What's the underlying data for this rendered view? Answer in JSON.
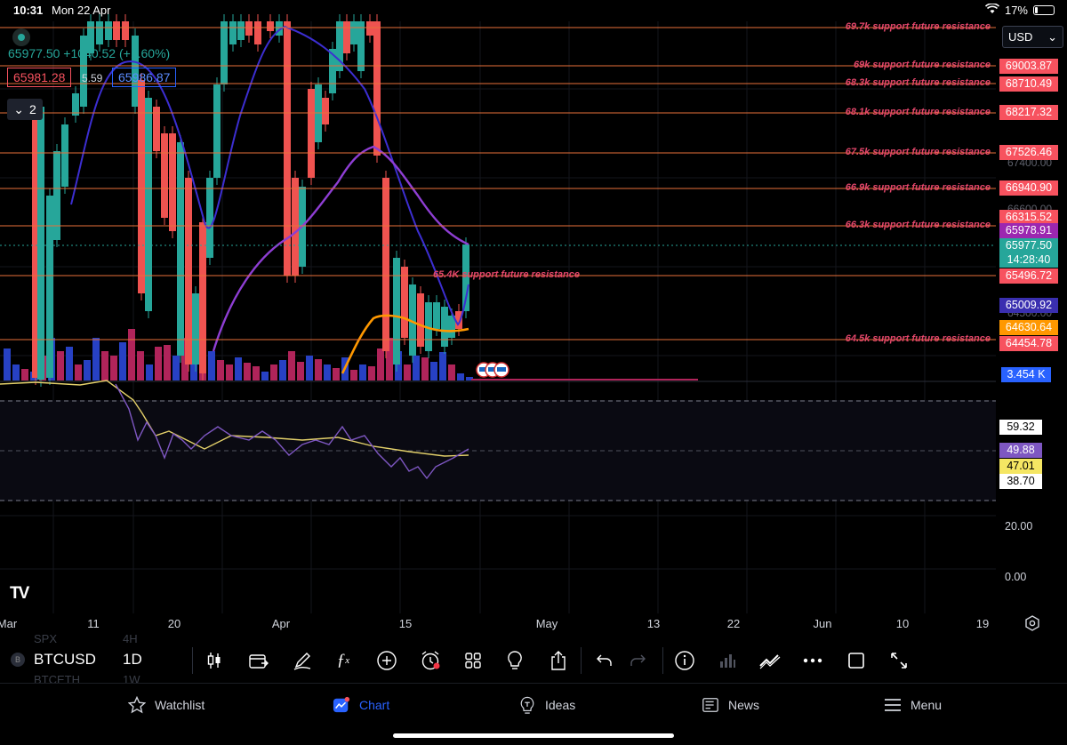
{
  "status_bar": {
    "time": "10:31",
    "date": "Mon 22 Apr",
    "battery": "17%"
  },
  "header": {
    "price": "65977.50",
    "change": "+1040.52",
    "change_pct": "(+1.60%)",
    "bid": "65981.28",
    "spread": "5.59",
    "ask": "65986.87",
    "layout_count": "2",
    "currency": "USD",
    "currency_chevron": "⌄"
  },
  "levels": [
    {
      "label": "69.7k support future resistance",
      "price": 69700
    },
    {
      "label": "69k support future resistance",
      "price": 69003.87
    },
    {
      "label": "68.3k support future resistance",
      "price": 68710.49
    },
    {
      "label": "68.1k support future resistance",
      "price": 68217.32
    },
    {
      "label": "67.5k support future resistance",
      "price": 67526.46
    },
    {
      "label": "66.9k support future resistance",
      "price": 66940.9
    },
    {
      "label": "66.3k support future resistance",
      "price": 66315.52
    },
    {
      "label": "65.4K support future resistance",
      "price": 65496.72
    },
    {
      "label": "64.5k support future resistance",
      "price": 64454.78
    }
  ],
  "price_tags": [
    {
      "text": "69003.87",
      "color": "#f7525f"
    },
    {
      "text": "68710.49",
      "color": "#f7525f"
    },
    {
      "text": "68217.32",
      "color": "#f7525f"
    },
    {
      "text": "67526.46",
      "color": "#f7525f"
    },
    {
      "text": "66940.90",
      "color": "#f7525f"
    },
    {
      "text": "66315.52",
      "color": "#f7525f"
    },
    {
      "text": "65978.91",
      "color": "#9c27b0"
    },
    {
      "text": "65977.50",
      "color": "#26a69a"
    },
    {
      "text": "14:28:40",
      "color": "#26a69a"
    },
    {
      "text": "65496.72",
      "color": "#f7525f"
    },
    {
      "text": "65009.92",
      "color": "#3a2fb0"
    },
    {
      "text": "64630.64",
      "color": "#ff9800"
    },
    {
      "text": "64454.78",
      "color": "#f7525f"
    },
    {
      "text": "3.454 K",
      "color": "#2962ff"
    }
  ],
  "axis_ghost_labels": [
    "67400.00",
    "66600.00",
    "64500.00"
  ],
  "rsi": {
    "tags": [
      {
        "text": "59.32",
        "color": "#000"
      },
      {
        "text": "49.88",
        "color": "#7e57c2"
      },
      {
        "text": "47.01",
        "color": "#f5e663"
      },
      {
        "text": "38.70",
        "color": "#fff"
      }
    ],
    "axis": [
      "20.00",
      "0.00"
    ]
  },
  "x_axis": [
    {
      "label": "Mar"
    },
    {
      "label": "11"
    },
    {
      "label": "20"
    },
    {
      "label": "Apr"
    },
    {
      "label": "15"
    },
    {
      "label": "May"
    },
    {
      "label": "13"
    },
    {
      "label": "22"
    },
    {
      "label": "Jun"
    },
    {
      "label": "10"
    },
    {
      "label": "19"
    }
  ],
  "symbol_panel": {
    "prev_symbol": "SPX",
    "prev_interval": "4H",
    "symbol": "BTCUSD",
    "interval": "1D",
    "next_symbol": "BTCETH",
    "next_interval": "1W"
  },
  "toolbar": [
    "candles-icon",
    "replay-icon",
    "draw-icon",
    "indicators-icon",
    "add-icon",
    "alert-icon",
    "layout-icon",
    "ideas-icon",
    "share-icon",
    "undo-icon",
    "redo-icon",
    "info-icon",
    "stats-icon",
    "trend-icon",
    "more-icon",
    "fullscreen-square-icon",
    "expand-icon"
  ],
  "bottom_nav": [
    {
      "label": "Watchlist",
      "icon": "star-icon"
    },
    {
      "label": "Chart",
      "icon": "chart-icon"
    },
    {
      "label": "Ideas",
      "icon": "bulb-icon"
    },
    {
      "label": "News",
      "icon": "news-icon"
    },
    {
      "label": "Menu",
      "icon": "menu-icon"
    }
  ],
  "logo": "TV"
}
